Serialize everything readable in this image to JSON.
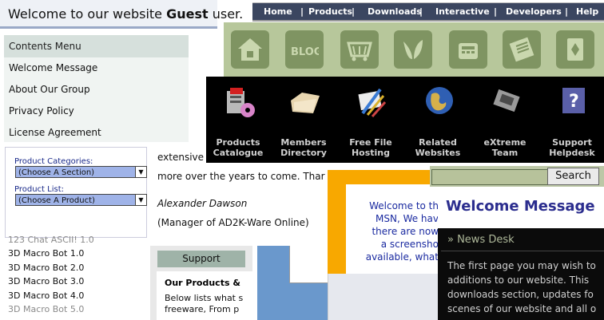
{
  "welcome_bar": {
    "prefix": "Welcome to our website ",
    "user": "Guest",
    "suffix": " user."
  },
  "contents_menu": {
    "header": "Contents Menu",
    "items": [
      "Welcome Message",
      "About Our Group",
      "Privacy Policy",
      "License Agreement"
    ]
  },
  "filters": {
    "categories_label": "Product Categories:",
    "categories_selected": "(Choose A Section)",
    "list_label": "Product List:",
    "list_selected": "(Choose A Product)"
  },
  "products": [
    {
      "name": "123 Chat ASCII! 1.0",
      "color": "#8a8a8a"
    },
    {
      "name": "3D Macro Bot 1.0",
      "color": "#111111"
    },
    {
      "name": "3D Macro Bot 2.0",
      "color": "#111111"
    },
    {
      "name": "3D Macro Bot 3.0",
      "color": "#111111"
    },
    {
      "name": "3D Macro Bot 4.0",
      "color": "#111111"
    },
    {
      "name": "3D Macro Bot 5.0",
      "color": "#8a8a8a"
    }
  ],
  "nav": {
    "links": [
      "Home",
      "Products",
      "Downloads",
      "Interactive",
      "Developers",
      "Help"
    ],
    "separator": "|"
  },
  "icon_strip": [
    "home-icon",
    "blog-icon",
    "basket-icon",
    "leaf-icon",
    "phone-icon",
    "newspaper-icon",
    "cards-icon"
  ],
  "black_panel": {
    "items": [
      {
        "line1": "Products",
        "line2": "Catalogue",
        "icon": "toolbox-icon"
      },
      {
        "line1": "Members",
        "line2": "Directory",
        "icon": "folder-icon"
      },
      {
        "line1": "Free File",
        "line2": "Hosting",
        "icon": "tools-icon"
      },
      {
        "line1": "Related",
        "line2": "Websites",
        "icon": "globe-icon"
      },
      {
        "line1": "eXtreme",
        "line2": "Team",
        "icon": "chip-icon"
      },
      {
        "line1": "Support",
        "line2": "Helpdesk",
        "icon": "help-icon"
      }
    ]
  },
  "article": {
    "line1": "extensive",
    "line2": "more over the years to come.  Thar",
    "author": "Alexander Dawson",
    "role": "(Manager of AD2K-Ware Online)"
  },
  "support": {
    "button": "Support",
    "heading": "Our Products &",
    "body1": "Below lists what s",
    "body2": "freeware, From p"
  },
  "msn": {
    "lines": [
      "Welcome to th",
      "MSN, We hav",
      "there are now",
      "a screensho",
      "available, what"
    ]
  },
  "search": {
    "button": "Search",
    "value": ""
  },
  "welcome_message": {
    "title": "Welcome Message"
  },
  "news": {
    "title": "» News Desk",
    "lines": [
      "The first page you may wish to",
      "additions to our website. This",
      "downloads section, updates fo",
      "scenes of our website and all o"
    ]
  },
  "colors": {
    "nav_bg": "#3b4660",
    "icon_strip_bg": "#b7c79b",
    "tile": "#7f9462",
    "welcome_title": "#2b2d8e",
    "msn_frame": "#f8a800"
  }
}
